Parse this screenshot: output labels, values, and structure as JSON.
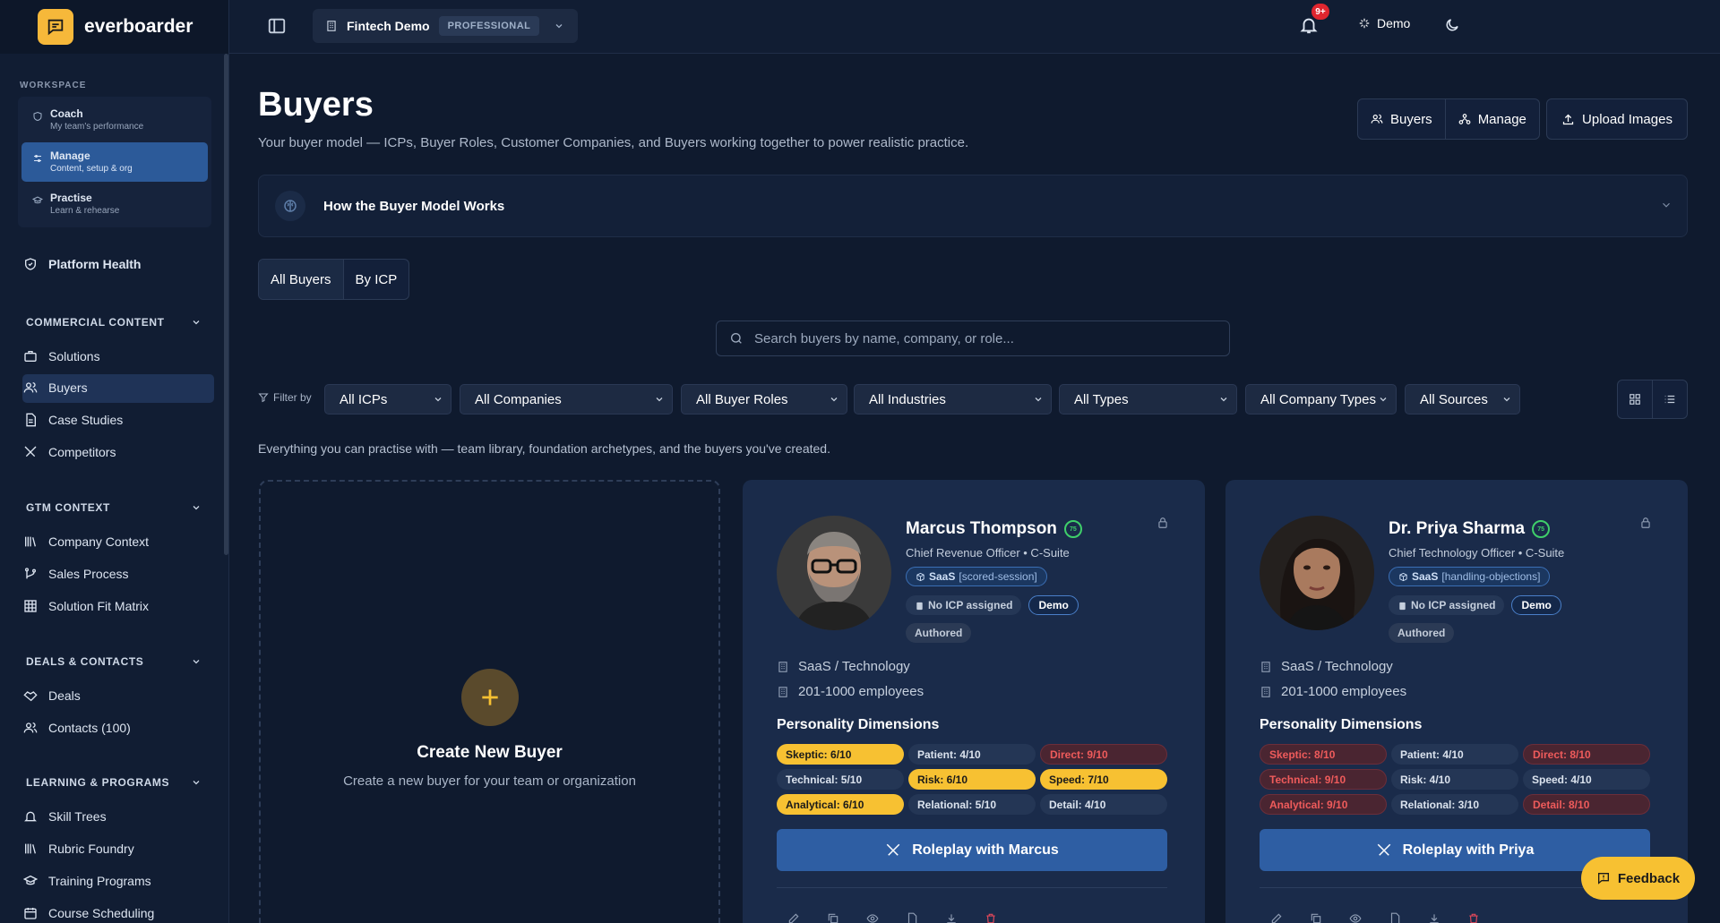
{
  "brand": {
    "name": "everboarder"
  },
  "colors": {
    "accent": "#f7c132",
    "primary": "#2e5ea3",
    "background": "#0f1a2e",
    "danger": "#ef5b5b",
    "success": "#3fcf6a"
  },
  "topbar": {
    "org_name": "Fintech Demo",
    "org_tier": "PROFESSIONAL",
    "notif_badge": "9+",
    "user_label": "Demo"
  },
  "sidebar": {
    "workspace_label": "WORKSPACE",
    "workspace_items": [
      {
        "title": "Coach",
        "subtitle": "My team's performance",
        "icon": "coach-icon"
      },
      {
        "title": "Manage",
        "subtitle": "Content, setup & org",
        "icon": "manage-icon",
        "active": true
      },
      {
        "title": "Practise",
        "subtitle": "Learn & rehearse",
        "icon": "practise-icon"
      }
    ],
    "platform_health": "Platform Health",
    "sections": [
      {
        "title": "COMMERCIAL CONTENT",
        "items": [
          "Solutions",
          "Buyers",
          "Case Studies",
          "Competitors"
        ]
      },
      {
        "title": "GTM CONTEXT",
        "items": [
          "Company Context",
          "Sales Process",
          "Solution Fit Matrix"
        ]
      },
      {
        "title": "DEALS & CONTACTS",
        "items": [
          "Deals",
          "Contacts (100)"
        ]
      },
      {
        "title": "LEARNING & PROGRAMS",
        "items": [
          "Skill Trees",
          "Rubric Foundry",
          "Training Programs",
          "Course Scheduling"
        ]
      }
    ]
  },
  "page": {
    "title": "Buyers",
    "subtitle": "Your buyer model — ICPs, Buyer Roles, Customer Companies, and Buyers working together to power realistic practice.",
    "header_buttons": {
      "buyers": "Buyers",
      "manage": "Manage",
      "upload": "Upload Images"
    },
    "howto_title": "How the Buyer Model Works",
    "tabs": [
      "All Buyers",
      "By ICP"
    ],
    "search_placeholder": "Search buyers by name, company, or role...",
    "filter_label": "Filter by",
    "filters": [
      "All ICPs",
      "All Companies",
      "All Buyer Roles",
      "All Industries",
      "All Types",
      "All Company Types",
      "All Sources"
    ],
    "intro": "Everything you can practise with — team library, foundation archetypes, and the buyers you've created."
  },
  "create_card": {
    "title": "Create New Buyer",
    "subtitle": "Create a new buyer for your team or organization"
  },
  "buyers": [
    {
      "name": "Marcus Thompson",
      "score": "75",
      "role": "Chief Revenue Officer • C-Suite",
      "saas_label": "SaaS",
      "saas_tag": "[scored-session]",
      "no_icp": "No ICP assigned",
      "demo": "Demo",
      "authored": "Authored",
      "industry": "SaaS / Technology",
      "employees": "201-1000 employees",
      "pd_title": "Personality Dimensions",
      "dimensions": [
        {
          "label": "Skeptic: 6/10",
          "level": "y"
        },
        {
          "label": "Patient: 4/10",
          "level": "n"
        },
        {
          "label": "Direct: 9/10",
          "level": "r"
        },
        {
          "label": "Technical: 5/10",
          "level": "n"
        },
        {
          "label": "Risk: 6/10",
          "level": "y"
        },
        {
          "label": "Speed: 7/10",
          "level": "y"
        },
        {
          "label": "Analytical: 6/10",
          "level": "y"
        },
        {
          "label": "Relational: 5/10",
          "level": "n"
        },
        {
          "label": "Detail: 4/10",
          "level": "n"
        }
      ],
      "roleplay": "Roleplay with Marcus"
    },
    {
      "name": "Dr. Priya Sharma",
      "score": "75",
      "role": "Chief Technology Officer • C-Suite",
      "saas_label": "SaaS",
      "saas_tag": "[handling-objections]",
      "no_icp": "No ICP assigned",
      "demo": "Demo",
      "authored": "Authored",
      "industry": "SaaS / Technology",
      "employees": "201-1000 employees",
      "pd_title": "Personality Dimensions",
      "dimensions": [
        {
          "label": "Skeptic: 8/10",
          "level": "r"
        },
        {
          "label": "Patient: 4/10",
          "level": "n"
        },
        {
          "label": "Direct: 8/10",
          "level": "r"
        },
        {
          "label": "Technical: 9/10",
          "level": "r"
        },
        {
          "label": "Risk: 4/10",
          "level": "n"
        },
        {
          "label": "Speed: 4/10",
          "level": "n"
        },
        {
          "label": "Analytical: 9/10",
          "level": "r"
        },
        {
          "label": "Relational: 3/10",
          "level": "n"
        },
        {
          "label": "Detail: 8/10",
          "level": "r"
        }
      ],
      "roleplay": "Roleplay with Priya"
    }
  ],
  "feedback": "Feedback"
}
